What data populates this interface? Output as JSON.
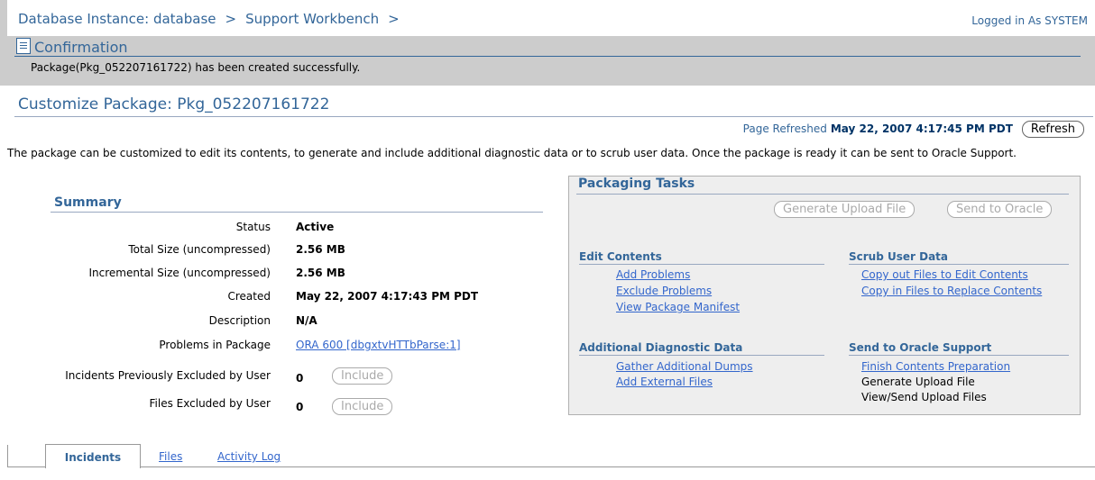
{
  "header": {
    "breadcrumb": [
      "Database Instance: database",
      "Support Workbench"
    ],
    "separator": ">",
    "logged_in": "Logged in As SYSTEM"
  },
  "confirmation": {
    "title": "Confirmation",
    "message": "Package(Pkg_052207161722) has been created successfully."
  },
  "page": {
    "title": "Customize Package: Pkg_052207161722",
    "refreshed_label": "Page Refreshed",
    "refreshed_time": "May 22, 2007 4:17:45 PM PDT",
    "refresh_button": "Refresh",
    "description": "The package can be customized to edit its contents, to generate and include additional diagnostic data or to scrub user data. Once the package is ready it can be sent to Oracle Support."
  },
  "summary": {
    "title": "Summary",
    "rows": [
      {
        "label": "Status",
        "value": "Active"
      },
      {
        "label": "Total Size (uncompressed)",
        "value": "2.56 MB"
      },
      {
        "label": "Incremental Size (uncompressed)",
        "value": "2.56 MB"
      },
      {
        "label": "Created",
        "value": "May 22, 2007 4:17:43 PM PDT"
      },
      {
        "label": "Description",
        "value": "N/A"
      },
      {
        "label": "Problems in Package",
        "value": "ORA 600 [dbgxtvHTTbParse:1]"
      },
      {
        "label": "Incidents Previously Excluded by User",
        "value": "0",
        "button": "Include"
      },
      {
        "label": "Files Excluded by User",
        "value": "0",
        "button": "Include"
      }
    ]
  },
  "packaging_tasks": {
    "title": "Packaging Tasks",
    "generate_button": "Generate Upload File",
    "send_button": "Send to Oracle",
    "edit_contents": {
      "title": "Edit Contents",
      "items": [
        "Add Problems",
        "Exclude Problems",
        "View Package Manifest"
      ]
    },
    "scrub_user_data": {
      "title": "Scrub User Data",
      "items": [
        "Copy out Files to Edit Contents",
        "Copy in Files to Replace Contents"
      ]
    },
    "additional_diagnostic": {
      "title": "Additional Diagnostic Data",
      "items": [
        "Gather Additional Dumps",
        "Add External Files"
      ]
    },
    "send_to_oracle": {
      "title": "Send to Oracle Support",
      "items": [
        "Finish Contents Preparation",
        "Generate Upload File",
        "View/Send Upload Files"
      ]
    }
  },
  "tabs": [
    "Incidents",
    "Files",
    "Activity Log"
  ]
}
